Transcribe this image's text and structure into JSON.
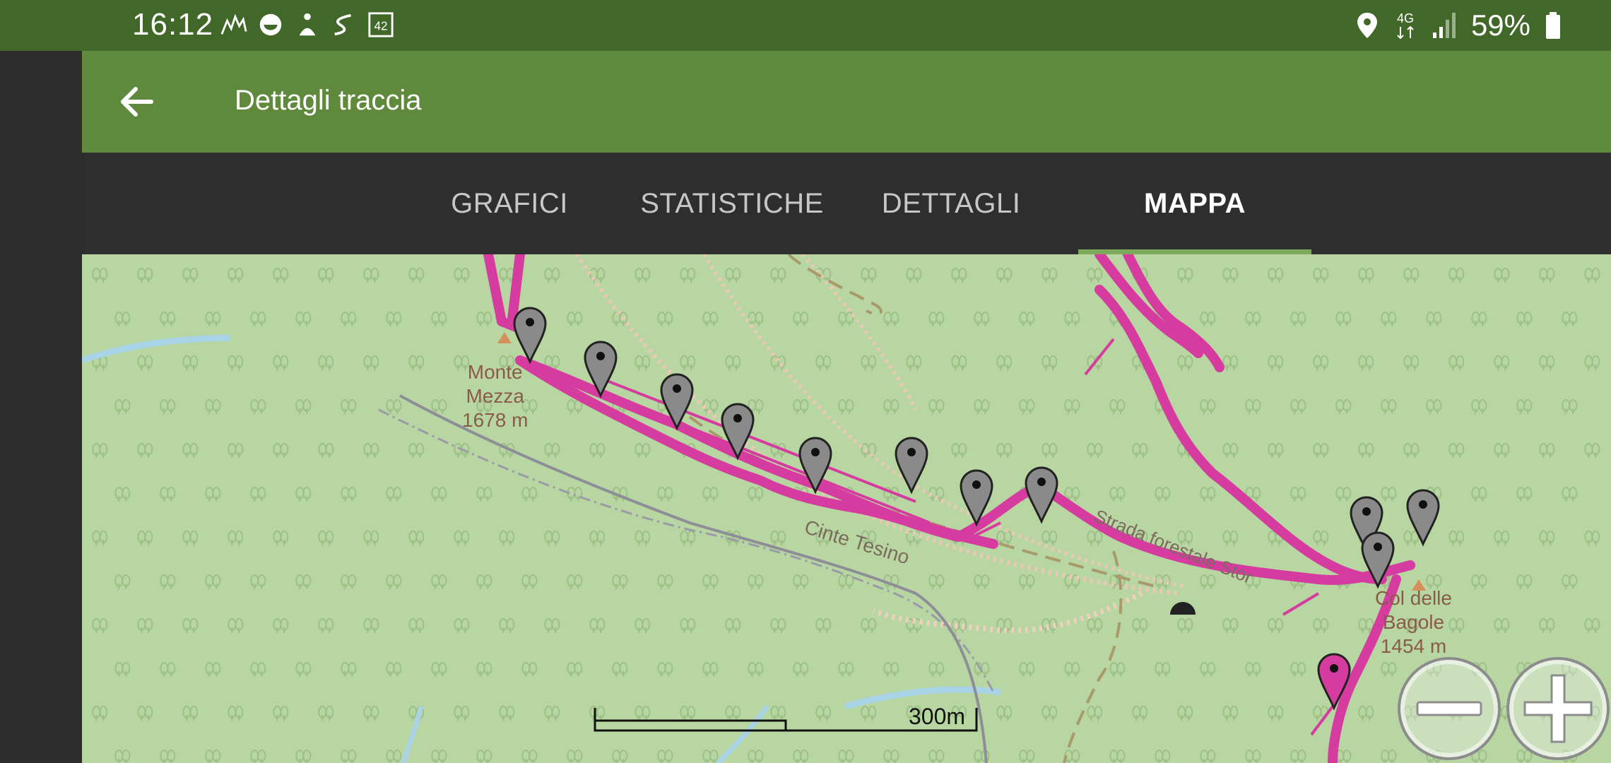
{
  "status_bar": {
    "time": "16:12",
    "battery_percent": "59%",
    "network": "4G",
    "left_icons": [
      "activity-graph-icon",
      "face-icon",
      "figure-icon",
      "route-icon",
      "badge-42-icon"
    ],
    "right_icons": [
      "location-pin-icon",
      "4g-data-icon",
      "signal-icon",
      "battery-icon"
    ],
    "badge_text": "42"
  },
  "app_bar": {
    "title": "Dettagli traccia",
    "back_icon": "arrow-back-icon"
  },
  "tabs": [
    {
      "label": "GRAFICI",
      "active": false
    },
    {
      "label": "STATISTICHE",
      "active": false
    },
    {
      "label": "DETTAGLI",
      "active": false
    },
    {
      "label": "MAPPA",
      "active": true
    }
  ],
  "map": {
    "peak_label_1": {
      "name_line1": "Monte",
      "name_line2": "Mezza",
      "elevation": "1678 m"
    },
    "peak_label_2": {
      "name_line1": "Col delle",
      "name_line2": "Bagole",
      "elevation": "1454 m"
    },
    "road_label_1": "Cinte Tesino",
    "road_label_2": "Strada forestale Stor",
    "scale_label": "300m",
    "colors": {
      "background": "#b8d6a1",
      "track": "#d63ca0",
      "marker_gray": "#8a8a8a",
      "marker_pink": "#d63ca0"
    },
    "zoom_out_icon": "zoom-out-minus-icon",
    "zoom_in_icon": "zoom-in-plus-icon"
  }
}
